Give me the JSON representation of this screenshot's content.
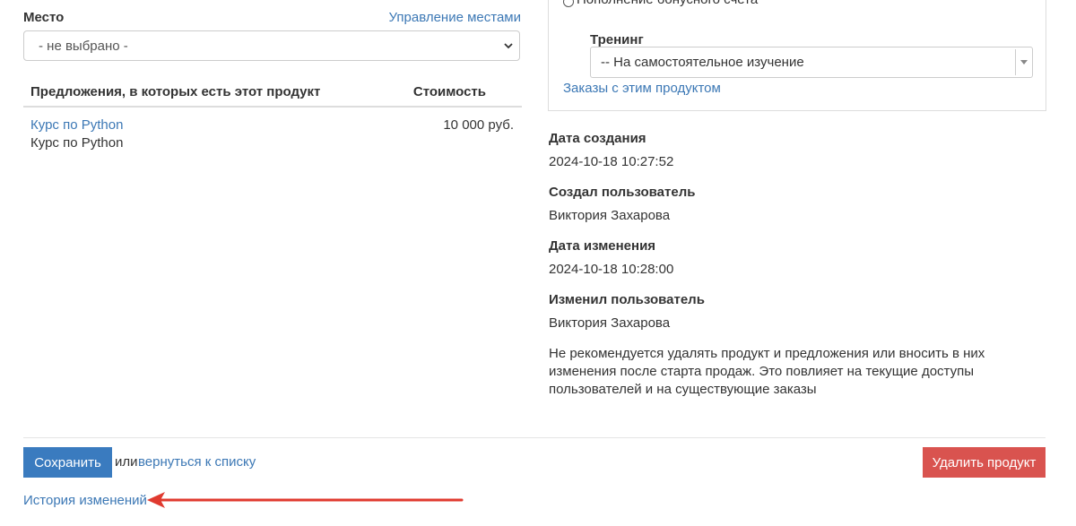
{
  "left": {
    "place_label": "Место",
    "manage_places_link": "Управление местами",
    "place_select_value": "- не выбрано -",
    "offers_header": "Предложения, в которых есть этот продукт",
    "price_header": "Стоимость",
    "offers": [
      {
        "link": "Курс по Python",
        "name": "Курс по Python",
        "price": "10 000 руб."
      }
    ]
  },
  "right": {
    "radio_label": "Пополнение бонусного счета",
    "training_label": "Тренинг",
    "training_select_value": "-- На самостоятельное изучение",
    "orders_link": "Заказы с этим продуктом",
    "created_date_label": "Дата создания",
    "created_date_value": "2024-10-18 10:27:52",
    "created_by_label": "Создал пользователь",
    "created_by_value": "Виктория Захарова",
    "modified_date_label": "Дата изменения",
    "modified_date_value": "2024-10-18 10:28:00",
    "modified_by_label": "Изменил пользователь",
    "modified_by_value": "Виктория Захарова",
    "warning_text": "Не рекомендуется удалять продукт и предложения или вносить в них изменения после старта продаж. Это повлияет на текущие доступы пользователей и на существующие заказы"
  },
  "footer": {
    "save_button": "Сохранить",
    "or_text": "или",
    "back_link": "вернуться к списку",
    "delete_button": "Удалить продукт",
    "history_link": "История изменений"
  },
  "colors": {
    "link": "#3c78b5",
    "save_button": "#3a7bbf",
    "delete_button": "#d9534f",
    "annotation_arrow": "#e03a2f"
  }
}
